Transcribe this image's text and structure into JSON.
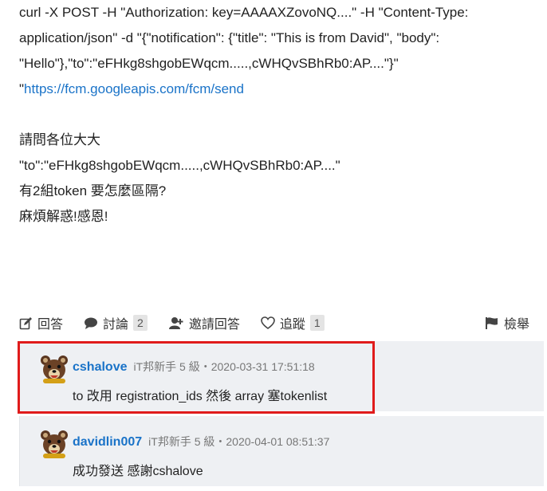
{
  "post": {
    "curl_text": "curl -X POST -H \"Authorization: key=AAAAXZovoNQ....\" -H \"Content-Type: application/json\" -d \"{\"notification\": {\"title\": \"This is from David\", \"body\": \"Hello\"},\"to\":\"eFHkg8shgobEWqcm.....,cWHQvSBhRb0:AP....\"}\"",
    "url_quote": "\"",
    "url": "https://fcm.googleapis.com/fcm/send",
    "lines": [
      "請問各位大大",
      "\"to\":\"eFHkg8shgobEWqcm.....,cWHQvSBhRb0:AP....\"",
      "有2組token 要怎麼區隔?",
      "麻煩解惑!感恩!"
    ]
  },
  "actions": {
    "answer_label": "回答",
    "discuss_label": "討論",
    "discuss_count": "2",
    "invite_label": "邀請回答",
    "follow_label": "追蹤",
    "follow_count": "1",
    "report_label": "檢舉"
  },
  "comments": [
    {
      "user": "cshalove",
      "meta": "iT邦新手 5 級・2020-03-31 17:51:18",
      "text": "to 改用 registration_ids 然後 array 塞tokenlist"
    },
    {
      "user": "davidlin007",
      "meta": "iT邦新手 5 級・2020-04-01 08:51:37",
      "text": "成功發送 感謝cshalove"
    }
  ],
  "colors": {
    "link": "#1a73c8",
    "highlight_border": "#e01b1b",
    "comment_bg": "#eef0f3"
  },
  "icons": [
    "edit-icon",
    "comment-icon",
    "user-plus-icon",
    "heart-icon",
    "flag-icon",
    "bear-avatar-icon"
  ]
}
